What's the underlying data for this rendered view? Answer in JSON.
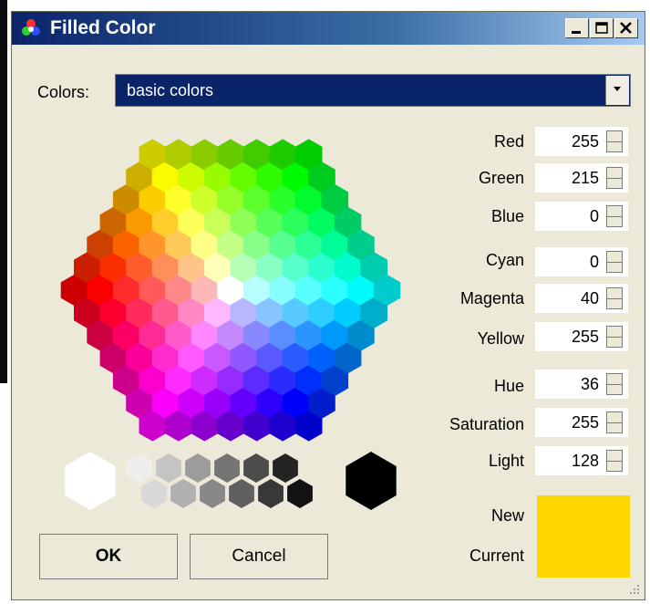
{
  "window": {
    "title": "Filled Color",
    "icon": "color-wheel-icon"
  },
  "colors": {
    "label": "Colors:",
    "selected": "basic colors"
  },
  "fields": {
    "red": {
      "label": "Red",
      "value": "255"
    },
    "green": {
      "label": "Green",
      "value": "215"
    },
    "blue": {
      "label": "Blue",
      "value": "0"
    },
    "cyan": {
      "label": "Cyan",
      "value": "0"
    },
    "magenta": {
      "label": "Magenta",
      "value": "40"
    },
    "yellow": {
      "label": "Yellow",
      "value": "255"
    },
    "hue": {
      "label": "Hue",
      "value": "36"
    },
    "saturation": {
      "label": "Saturation",
      "value": "255"
    },
    "light": {
      "label": "Light",
      "value": "128"
    }
  },
  "preview": {
    "new_label": "New",
    "current_label": "Current",
    "new_color": "#ffd700",
    "current_color": "#ffd700"
  },
  "buttons": {
    "ok": "OK",
    "cancel": "Cancel"
  }
}
